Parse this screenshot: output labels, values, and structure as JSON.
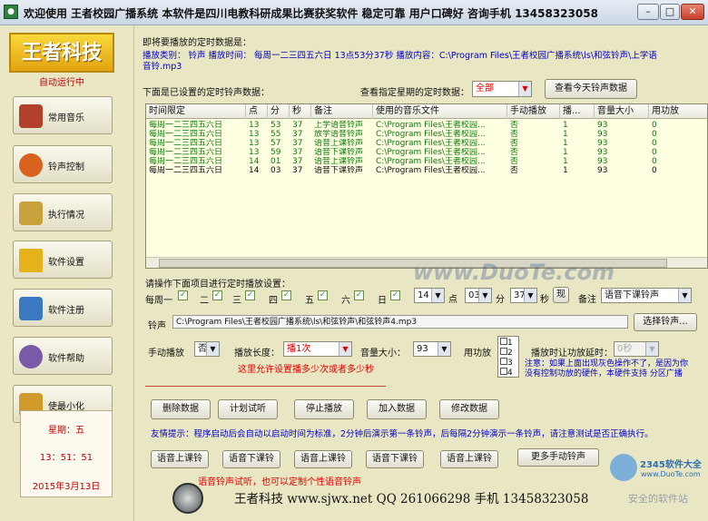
{
  "titlebar": {
    "title": "欢迎使用  王者校园广播系统  本软件是四川电教科研成果比赛获奖软件  稳定可靠  用户口碑好  咨询手机  13458323058",
    "min": "–",
    "max": "□",
    "close": "✕"
  },
  "sidebar": {
    "logo": "王者科技",
    "autorun": "自动运行中",
    "items": [
      {
        "label": "常用音乐",
        "color": "#b3402a"
      },
      {
        "label": "铃声控制",
        "color": "#d6621d"
      },
      {
        "label": "执行情况",
        "color": "#c9a13a"
      },
      {
        "label": "软件设置",
        "color": "#e5b21a"
      },
      {
        "label": "软件注册",
        "color": "#3a78c2"
      },
      {
        "label": "软件帮助",
        "color": "#7a5aa8"
      },
      {
        "label": "使最小化",
        "color": "#d09a2a"
      }
    ],
    "clock": {
      "weekday": "星期：五",
      "time": "13：51：51",
      "date": "2015年3月13日"
    }
  },
  "info": {
    "heading": "即将要播放的定时数据是：",
    "detail_line1": "播放类别：  铃声  播放时间：  每周一二三四五六日    13点53分37秒  播放内容：C:\\Program Files\\王者校园广播系统\\ls\\和弦铃声\\上学语",
    "detail_line2": "音铃.mp3"
  },
  "filter": {
    "set_label": "下面是已设置的定时铃声数据：",
    "view_label": "查看指定星期的定时数据：",
    "select_value": "全部",
    "today_button": "查看今天铃声数据"
  },
  "table": {
    "headers": [
      "时间限定",
      "点",
      "分",
      "秒",
      "备注",
      "使用的音乐文件",
      "手动播放",
      "播...",
      "音量大小",
      "用功放"
    ],
    "rows": [
      [
        "每周一二三四五六日",
        "13",
        "53",
        "37",
        "上学语音铃声",
        "C:\\Program Files\\王者校园...",
        "否",
        "1",
        "93",
        "0"
      ],
      [
        "每周一二三四五六日",
        "13",
        "55",
        "37",
        "放学语音铃声",
        "C:\\Program Files\\王者校园...",
        "否",
        "1",
        "93",
        "0"
      ],
      [
        "每周一二三四五六日",
        "13",
        "57",
        "37",
        "语音上课铃声",
        "C:\\Program Files\\王者校园...",
        "否",
        "1",
        "93",
        "0"
      ],
      [
        "每周一二三四五六日",
        "13",
        "59",
        "37",
        "语音下课铃声",
        "C:\\Program Files\\王者校园...",
        "否",
        "1",
        "93",
        "0"
      ],
      [
        "每周一二三四五六日",
        "14",
        "01",
        "37",
        "语音上课铃声",
        "C:\\Program Files\\王者校园...",
        "否",
        "1",
        "93",
        "0"
      ],
      [
        "每周一二三四五六日",
        "14",
        "03",
        "37",
        "语音下课铃声",
        "C:\\Program Files\\王者校园...",
        "否",
        "1",
        "93",
        "0"
      ]
    ]
  },
  "settings": {
    "heading": "请操作下面项目进行定时播放设置：",
    "days": [
      "每周一",
      "二",
      "三",
      "四",
      "五",
      "六",
      "日"
    ],
    "check": "✓",
    "hour": "14",
    "hour_label": "点",
    "minute": "03",
    "minute_label": "分",
    "second": "37",
    "second_label": "秒",
    "now_button": "现",
    "note_label": "备注",
    "note_value": "语音下课铃声",
    "ring_label": "铃声",
    "ring_path": "C:\\Program Files\\王者校园广播系统\\ls\\和弦铃声\\和弦铃声4.mp3",
    "choose_button": "选择铃声...",
    "manual_label": "手动播放",
    "manual_value": "否",
    "length_label": "播放长度：",
    "length_value": "播1次",
    "length_hint": "这里允许设置播多少次或者多少秒",
    "volume_label": "音量大小：",
    "volume_value": "93",
    "amp_label": "用功放",
    "amp_options": [
      "1",
      "2",
      "3",
      "4"
    ],
    "delay_label": "播放时让功放延时：",
    "delay_value": "0秒",
    "amp_note": "注意：如果上面出现灰色操作不了，是因为你没有控制功放的硬件，本硬件支持 分区广播"
  },
  "actions": {
    "delete": "删除数据",
    "preview": "计划试听",
    "stop": "停止播放",
    "add": "加入数据",
    "modify": "修改数据"
  },
  "tip": "友情提示：程序启动后会自动以启动时间为标准，2分钟后演示第一条铃声，后每隔2分钟演示一条铃声，请注意测试是否正确执行。",
  "preview_buttons": [
    "语音上课铃",
    "语音下课铃",
    "语音上课铃",
    "语音下课铃",
    "语音上课铃"
  ],
  "more_button": "更多手动铃声",
  "preview_hint": "语音铃声试听，也可以定制个性语音铃声",
  "footer": "王者科技    www.sjwx.net  QQ  261066298  手机  13458323058",
  "watermarks": {
    "site": "www.DuoTe.com",
    "brand": "2345软件大全",
    "brand_url": "www.DuoTe.com",
    "brand_slogan": "安全的软件站"
  }
}
